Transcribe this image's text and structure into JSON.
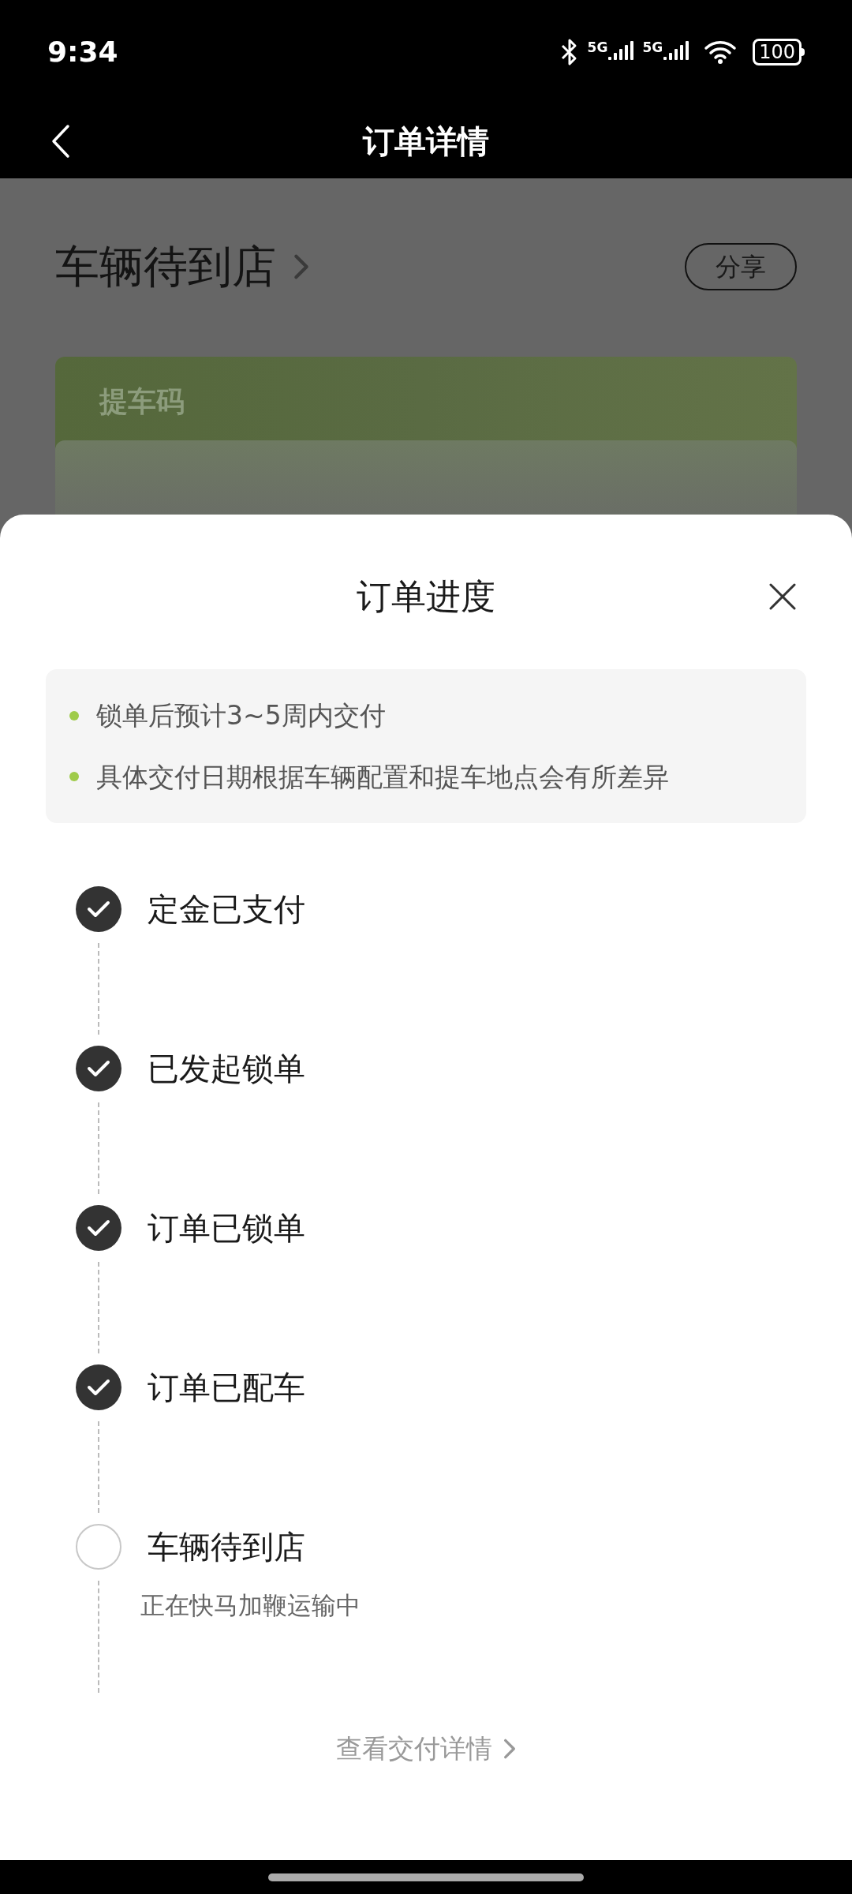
{
  "status_bar": {
    "time": "9:34",
    "networks": [
      "5G",
      "5G"
    ],
    "battery": "100"
  },
  "nav": {
    "title": "订单详情"
  },
  "background": {
    "status_title": "车辆待到店",
    "share": "分享",
    "card_label": "提车码"
  },
  "sheet": {
    "title": "订单进度",
    "notes": [
      "锁单后预计3~5周内交付",
      "具体交付日期根据车辆配置和提车地点会有所差异"
    ],
    "steps": [
      {
        "label": "定金已支付",
        "done": true
      },
      {
        "label": "已发起锁单",
        "done": true
      },
      {
        "label": "订单已锁单",
        "done": true
      },
      {
        "label": "订单已配车",
        "done": true
      },
      {
        "label": "车辆待到店",
        "done": false,
        "description": "正在快马加鞭运输中"
      }
    ],
    "link": "查看交付详情"
  }
}
